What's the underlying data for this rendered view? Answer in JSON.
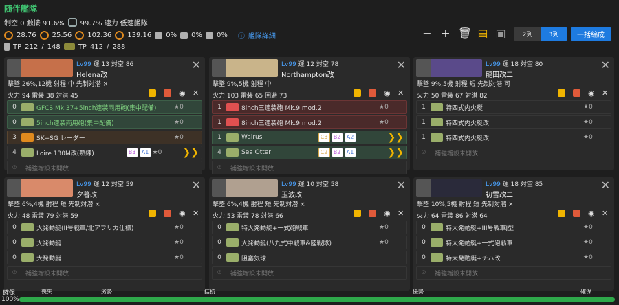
{
  "fleet": {
    "title": "随伴艦隊",
    "stat_line1": "制空 0 触接 91.6%",
    "stat_line1b": "99.7% 速力 低速艦隊",
    "stat_line2": [
      "28.76",
      "25.56",
      "102.36",
      "139.16"
    ],
    "stat_line2b": [
      "0%",
      "0%",
      "0%"
    ],
    "stat_line3a": "212",
    "stat_line3b": "148",
    "stat_line3c": "412",
    "stat_line3d": "288",
    "detail_label": "艦隊詳細",
    "col2_label": "2列",
    "col3_label": "3列",
    "bulk_label": "一括編成"
  },
  "ships": [
    {
      "level": "Lv99",
      "luck": "運 13",
      "aa": "対空 86",
      "name": "Helena改",
      "stats1": "撃墜 26%,12機 射程 中 先制対潜 ×",
      "stats2": "火力 94 雷装 38 対潜 45",
      "slots": [
        {
          "count": "0",
          "name": "GFCS Mk.37+5inch連装両用砲(集中配備)",
          "imp": "★0",
          "color": "g"
        },
        {
          "count": "0",
          "name": "5inch連装両用砲(集中配備)",
          "imp": "★0",
          "color": "g"
        },
        {
          "count": "3",
          "name": "SK+SG レーダー",
          "imp": "★0",
          "color": "o"
        },
        {
          "count": "4",
          "name": "Loire 130M改(熟練)",
          "imp": "★0",
          "color": "e",
          "badges": [
            "B3",
            "A1"
          ]
        },
        {
          "count": "",
          "name": "補強増設未開放",
          "imp": "",
          "color": "e",
          "empty": true
        }
      ]
    },
    {
      "level": "Lv99",
      "luck": "運 12",
      "aa": "対空 78",
      "name": "Northampton改",
      "stats1": "撃墜 9%,5機 射程 中",
      "stats2": "火力 103 雷装 65 回避 73",
      "slots": [
        {
          "count": "1",
          "name": "8inch三連装砲 Mk.9 mod.2",
          "imp": "★0",
          "color": "r"
        },
        {
          "count": "1",
          "name": "8inch三連装砲 Mk.9 mod.2",
          "imp": "★0",
          "color": "r"
        },
        {
          "count": "1",
          "name": "Walrus",
          "imp": "",
          "color": "g",
          "badges": [
            "C3",
            "B2",
            "A2"
          ]
        },
        {
          "count": "4",
          "name": "Sea Otter",
          "imp": "",
          "color": "g",
          "badges": [
            "C2",
            "B2",
            "A1"
          ]
        },
        {
          "count": "",
          "name": "補強増設未開放",
          "imp": "",
          "color": "e",
          "empty": true
        }
      ]
    },
    {
      "level": "Lv99",
      "luck": "運 18",
      "aa": "対空 80",
      "name": "龍田改二",
      "stats1": "撃墜 9%,5機 射程 短 先制対潜 可",
      "stats2": "火力 50 雷装 67 対潜 82",
      "slots": [
        {
          "count": "1",
          "name": "特四式内火艇",
          "imp": "★0",
          "color": "e"
        },
        {
          "count": "1",
          "name": "特四式内火艇改",
          "imp": "★0",
          "color": "e"
        },
        {
          "count": "1",
          "name": "特四式内火艇改",
          "imp": "★0",
          "color": "e"
        },
        {
          "count": "",
          "name": "補強増設未開放",
          "imp": "",
          "color": "e",
          "empty": true
        }
      ]
    },
    {
      "level": "Lv99",
      "luck": "運 12",
      "aa": "対空 59",
      "name": "夕暮改",
      "stats1": "撃墜 6%,4機 射程 短 先制対潜 ×",
      "stats2": "火力 48 雷装 79 対潜 59",
      "slots": [
        {
          "count": "0",
          "name": "大発動艇(II号戦車/北アフリカ仕様)",
          "imp": "★0",
          "color": "e"
        },
        {
          "count": "0",
          "name": "大発動艇",
          "imp": "★0",
          "color": "e"
        },
        {
          "count": "0",
          "name": "大発動艇",
          "imp": "★0",
          "color": "e"
        },
        {
          "count": "",
          "name": "補強増設未開放",
          "imp": "",
          "color": "e",
          "empty": true
        }
      ]
    },
    {
      "level": "Lv99",
      "luck": "運 10",
      "aa": "対空 58",
      "name": "玉波改",
      "stats1": "撃墜 6%,4機 射程 短 先制対潜 ×",
      "stats2": "火力 53 雷装 78 対潜 66",
      "slots": [
        {
          "count": "0",
          "name": "特大発動艇+一式砲戦車",
          "imp": "★0",
          "color": "e"
        },
        {
          "count": "0",
          "name": "大発動艇(八九式中戦車&陸戦隊)",
          "imp": "★0",
          "color": "e"
        },
        {
          "count": "0",
          "name": "阻塞気球",
          "imp": "",
          "color": "e"
        },
        {
          "count": "",
          "name": "補強増設未開放",
          "imp": "",
          "color": "e",
          "empty": true
        }
      ]
    },
    {
      "level": "Lv99",
      "luck": "運 18",
      "aa": "対空 85",
      "name": "初雪改二",
      "stats1": "撃墜 10%,5機 射程 短 先制対潜 ×",
      "stats2": "火力 64 雷装 86 対潜 64",
      "slots": [
        {
          "count": "0",
          "name": "特大発動艇+III号戦車J型",
          "imp": "★0",
          "color": "e"
        },
        {
          "count": "0",
          "name": "特大発動艇+一式砲戦車",
          "imp": "★0",
          "color": "e"
        },
        {
          "count": "0",
          "name": "特大発動艇+チハ改",
          "imp": "★0",
          "color": "e"
        },
        {
          "count": "",
          "name": "補強増設未開放",
          "imp": "",
          "color": "e",
          "empty": true
        }
      ]
    }
  ],
  "airbar": {
    "label": "確保",
    "pct": "100%",
    "marks": [
      "喪失",
      "劣勢",
      "拮抗",
      "優勢",
      "確保"
    ],
    "fill": 1.0
  }
}
